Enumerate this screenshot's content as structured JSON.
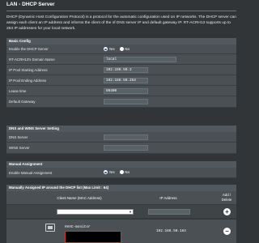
{
  "page": {
    "title": "LAN - DHCP Server",
    "description": "DHCP (Dynamic Host Configuration Protocol) is a protocol for the automatic configuration used on IP networks. The DHCP server can assign each client an IP address and informs the client of the of DNS server IP and default gateway IP. RT-ACRH13 supports up to 253 IP addresses for your local network."
  },
  "basic_config": {
    "header": "Basic Config",
    "enable_dhcp": {
      "label": "Enable the DHCP Server",
      "yes": "Yes",
      "no": "No",
      "selected": "Yes"
    },
    "domain_name": {
      "label": "RT-ACRH13's Domain Name",
      "value": "local"
    },
    "pool_start": {
      "label": "IP Pool Starting Address",
      "value": "192.168.50.2"
    },
    "pool_end": {
      "label": "IP Pool Ending Address",
      "value": "192.168.50.254"
    },
    "lease_time": {
      "label": "Lease time",
      "value": "86400"
    },
    "default_gateway": {
      "label": "Default Gateway",
      "value": ""
    }
  },
  "dns_wins": {
    "header": "DNS and WINS Server Setting",
    "dns_server": {
      "label": "DNS Server",
      "value": ""
    },
    "wins_server": {
      "label": "WINS Server",
      "value": ""
    }
  },
  "manual_assignment": {
    "header": "Manual Assignment",
    "enable": {
      "label": "Enable Manual Assignment",
      "yes": "Yes",
      "no": "No",
      "selected": "Yes"
    }
  },
  "manual_list": {
    "header": "Manually Assigned IP around the DHCP list (Max Limit : 64)",
    "columns": {
      "client_name": "Client Name (MAC Address)",
      "ip_address": "IP Address",
      "add_delete": "Add / Delete"
    },
    "add_icon": "plus-circle-icon",
    "delete_icon": "minus-circle-icon",
    "rows": [
      {
        "client_name": "HVAC-monitor",
        "ip": "192.168.50.184"
      }
    ]
  },
  "colors": {
    "background": "#313537",
    "section_header": "#51595e",
    "row": "#4a5054",
    "radio_selected": "#2a62c6",
    "redacted_border": "#c0392b"
  }
}
